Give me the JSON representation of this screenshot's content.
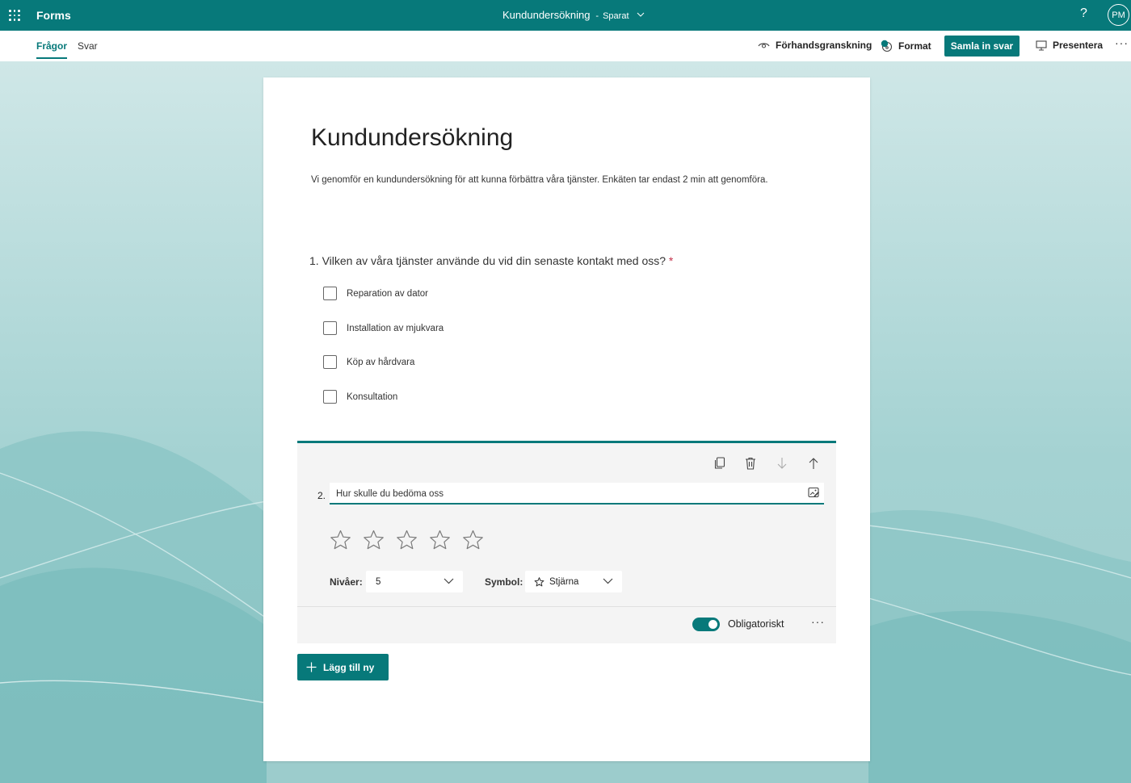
{
  "app": {
    "name": "Forms",
    "user_initials": "PM",
    "help_label": "?"
  },
  "document": {
    "title": "Kundundersökning",
    "separator": "-",
    "save_status": "Sparat"
  },
  "tabs": [
    {
      "label": "Frågor",
      "active": true
    },
    {
      "label": "Svar",
      "active": false
    }
  ],
  "commands": {
    "preview": "Förhandsgranskning",
    "format": "Format",
    "collect": "Samla in svar",
    "present": "Presentera",
    "more": "···"
  },
  "form": {
    "title": "Kundundersökning",
    "description": "Vi genomför en kundundersökning för att kunna förbättra våra tjänster. Enkäten tar endast 2 min att genomföra.",
    "questions": [
      {
        "number": "1.",
        "text": "Vilken av våra tjänster använde du vid din senaste kontakt med oss?",
        "required_mark": "*",
        "options": [
          "Reparation av dator",
          "Installation av mjukvara",
          "Köp av hårdvara",
          "Konsultation"
        ]
      },
      {
        "number": "2.",
        "text": "Hur skulle du bedöma oss",
        "levels_label": "Nivåer:",
        "levels_value": "5",
        "symbol_label": "Symbol:",
        "symbol_value": "Stjärna",
        "required_label": "Obligatoriskt",
        "required": true,
        "more": "···"
      }
    ],
    "add_new_label": "Lägg till ny"
  },
  "colors": {
    "accent": "#07797a",
    "required": "#c4314b",
    "background": "#a7d4d4"
  },
  "icons": [
    "waffle-icon",
    "chevron-down-icon",
    "eye-icon",
    "palette-icon",
    "monitor-icon",
    "copy-icon",
    "trash-icon",
    "arrow-down-icon",
    "arrow-up-icon",
    "image-icon",
    "star-icon",
    "plus-icon"
  ]
}
